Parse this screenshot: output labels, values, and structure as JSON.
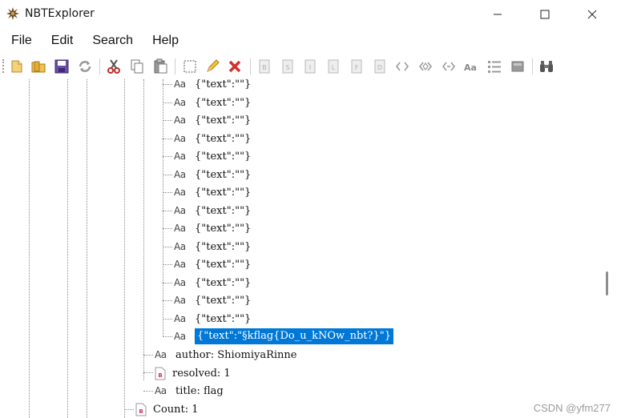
{
  "window": {
    "title": "NBTExplorer"
  },
  "menu": {
    "items": [
      "File",
      "Edit",
      "Search",
      "Help"
    ]
  },
  "toolbar": {
    "icons": [
      "open-file-icon",
      "open-folder-icon",
      "save-icon",
      "refresh-icon",
      "cut-icon",
      "copy-icon",
      "paste-icon",
      "rename-icon",
      "edit-icon",
      "delete-icon",
      "add-byte-icon",
      "add-short-icon",
      "add-int-icon",
      "add-long-icon",
      "add-float-icon",
      "add-double-icon",
      "add-byte-array-icon",
      "add-int-array-icon",
      "add-long-array-icon",
      "add-string-icon",
      "add-list-icon",
      "add-compound-icon",
      "find-icon"
    ],
    "text_tag_labels": {
      "b": "B",
      "s": "S",
      "i": "I",
      "l": "L",
      "f": "F",
      "d": "D",
      "aa": "Aa"
    }
  },
  "tree": {
    "aa_label": "Aa",
    "b_label": "B",
    "empty_text_entry": "{\"text\":\"\"}",
    "empty_count": 14,
    "selected_entry": "{\"text\":\"§kflag{Do_u_kNOw_nbt?}\"}",
    "author": "author: ShiomiyaRinne",
    "resolved": "resolved: 1",
    "title": "title: flag",
    "count": "Count: 1"
  },
  "watermark": "CSDN @yfm277",
  "colors": {
    "selection": "#0078d7",
    "delete": "#d32f2f"
  }
}
